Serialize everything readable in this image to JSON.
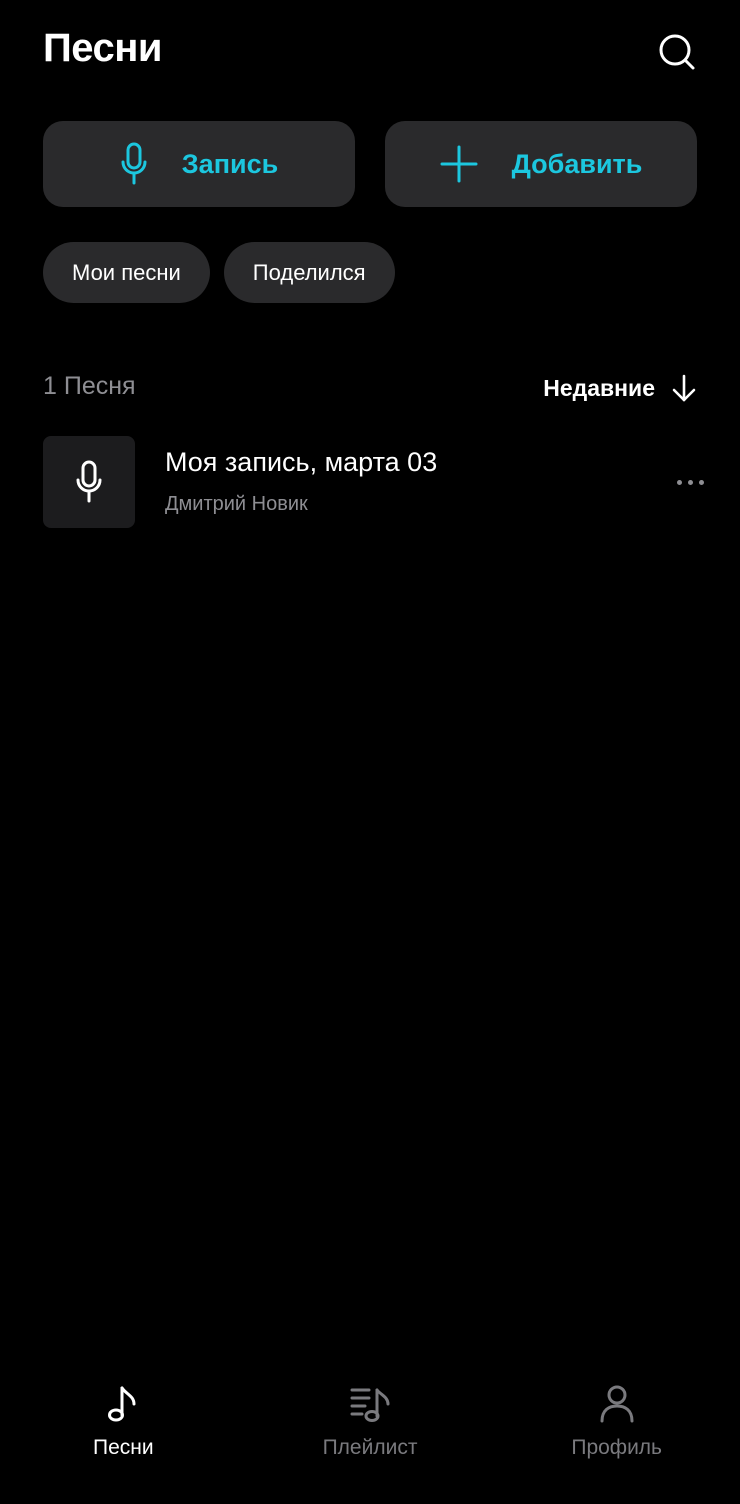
{
  "header": {
    "title": "Песни",
    "search_icon": "search-icon"
  },
  "actions": {
    "record_label": "Запись",
    "record_icon": "microphone-icon",
    "add_label": "Добавить",
    "add_icon": "plus-icon",
    "accent_color": "#1cc7df"
  },
  "filters": [
    {
      "label": "Мои песни"
    },
    {
      "label": "Поделился"
    }
  ],
  "list": {
    "count_label": "1 Песня",
    "sort_label": "Недавние",
    "sort_icon": "arrow-down-icon"
  },
  "songs": [
    {
      "title": "Моя запись, марта 03",
      "artist": "Дмитрий Новик",
      "thumb_icon": "microphone-icon",
      "menu_icon": "more-dots-icon"
    }
  ],
  "tabbar": {
    "items": [
      {
        "label": "Песни",
        "icon": "music-note-icon",
        "active": true
      },
      {
        "label": "Плейлист",
        "icon": "playlist-icon",
        "active": false
      },
      {
        "label": "Профиль",
        "icon": "person-icon",
        "active": false
      }
    ]
  },
  "colors": {
    "background": "#000000",
    "surface": "#2a2a2c",
    "accent": "#1cc7df",
    "secondary_text": "#8e8e93"
  }
}
